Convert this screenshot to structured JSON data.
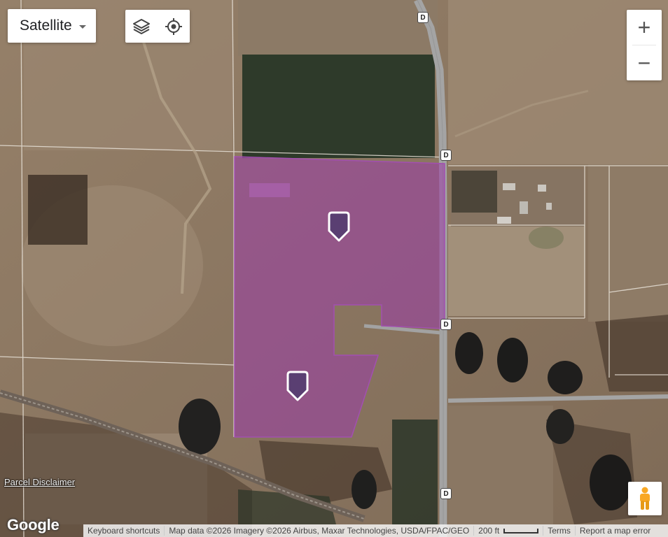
{
  "map_type": {
    "label": "Satellite"
  },
  "toolbar": {
    "layers_icon": "layers-icon",
    "locate_icon": "target-icon"
  },
  "zoom": {
    "in_label": "+",
    "out_label": "−"
  },
  "route_badges": {
    "label": "D"
  },
  "parcel_disclaimer": "Parcel Disclaimer",
  "logo": "Google",
  "attribution": {
    "keyboard_shortcuts": "Keyboard shortcuts",
    "map_data": "Map data ©2026 Imagery ©2026 Airbus, Maxar Technologies, USDA/FPAC/GEO",
    "scale": "200 ft",
    "terms": "Terms",
    "report": "Report a map error"
  },
  "colors": {
    "parcel_fill": "#9b3fa6",
    "marker_fill": "#5a3f72",
    "marker_stroke": "#ffffff",
    "road": "#a4a4a4"
  }
}
